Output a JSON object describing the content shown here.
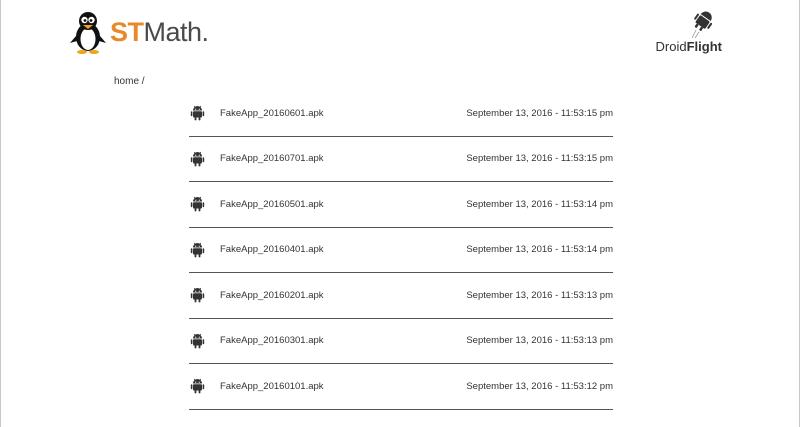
{
  "header": {
    "brand_left": {
      "st": "ST",
      "math": "Math",
      "mark": "."
    },
    "brand_right": {
      "droid": "Droid",
      "flight": "Flight"
    }
  },
  "breadcrumb": {
    "text": "home /"
  },
  "files": [
    {
      "name": "FakeApp_20160601.apk",
      "date": "September 13, 2016 - 11:53:15 pm",
      "icon": "android-icon"
    },
    {
      "name": "FakeApp_20160701.apk",
      "date": "September 13, 2016 - 11:53:15 pm",
      "icon": "android-icon"
    },
    {
      "name": "FakeApp_20160501.apk",
      "date": "September 13, 2016 - 11:53:14 pm",
      "icon": "android-icon"
    },
    {
      "name": "FakeApp_20160401.apk",
      "date": "September 13, 2016 - 11:53:14 pm",
      "icon": "android-icon"
    },
    {
      "name": "FakeApp_20160201.apk",
      "date": "September 13, 2016 - 11:53:13 pm",
      "icon": "android-icon"
    },
    {
      "name": "FakeApp_20160301.apk",
      "date": "September 13, 2016 - 11:53:13 pm",
      "icon": "android-icon"
    },
    {
      "name": "FakeApp_20160101.apk",
      "date": "September 13, 2016 - 11:53:12 pm",
      "icon": "android-icon"
    }
  ],
  "colors": {
    "accent": "#e8892b",
    "text": "#333333",
    "divider": "#555555"
  }
}
